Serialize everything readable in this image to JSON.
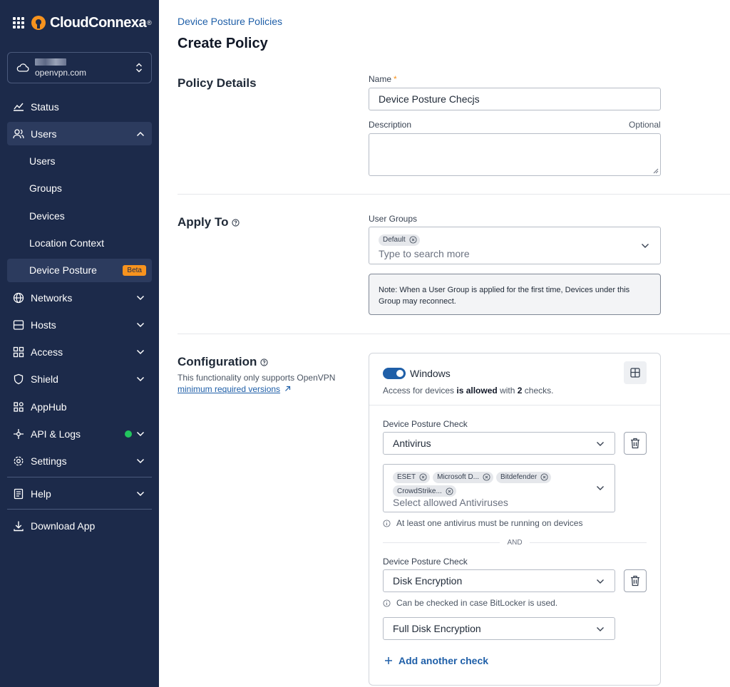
{
  "brand": {
    "name": "CloudConnexa",
    "reg": "®"
  },
  "org": {
    "domain": "openvpn.com"
  },
  "sidebar": {
    "items": [
      {
        "label": "Status"
      },
      {
        "label": "Users"
      },
      {
        "label": "Users"
      },
      {
        "label": "Groups"
      },
      {
        "label": "Devices"
      },
      {
        "label": "Location Context"
      },
      {
        "label": "Device Posture",
        "badge": "Beta"
      },
      {
        "label": "Networks"
      },
      {
        "label": "Hosts"
      },
      {
        "label": "Access"
      },
      {
        "label": "Shield"
      },
      {
        "label": "AppHub"
      },
      {
        "label": "API & Logs"
      },
      {
        "label": "Settings"
      },
      {
        "label": "Help"
      },
      {
        "label": "Download App"
      }
    ]
  },
  "header": {
    "breadcrumb": "Device Posture Policies",
    "title": "Create Policy"
  },
  "policy_details": {
    "title": "Policy Details",
    "name_label": "Name",
    "name_required": "*",
    "name_value": "Device Posture Checjs",
    "description_label": "Description",
    "description_optional": "Optional",
    "description_value": ""
  },
  "apply_to": {
    "title": "Apply To",
    "user_groups_label": "User Groups",
    "chips": [
      "Default"
    ],
    "search_placeholder": "Type to search more",
    "note": "Note: When a User Group is applied for the first time, Devices under this Group may reconnect."
  },
  "configuration": {
    "title": "Configuration",
    "subtitle": "This functionality only supports OpenVPN",
    "link": "minimum required versions",
    "os_name": "Windows",
    "access_pre": "Access for devices ",
    "access_bold": "is allowed",
    "access_mid": " with ",
    "access_count": "2",
    "access_post": " checks.",
    "check1": {
      "label": "Device Posture Check",
      "value": "Antivirus",
      "chips": [
        "ESET",
        "Microsoft D...",
        "Bitdefender",
        "CrowdStrike..."
      ],
      "placeholder": "Select allowed Antiviruses",
      "info": "At least one antivirus must be running on devices"
    },
    "and_label": "AND",
    "check2": {
      "label": "Device Posture Check",
      "value": "Disk Encryption",
      "info": "Can be checked in case BitLocker is used.",
      "sub_value": "Full Disk Encryption"
    },
    "add_check": "Add another check"
  },
  "colors": {
    "sidebar_bg": "#1c2a4a",
    "accent": "#1f5fa8",
    "brand_orange": "#f7931e",
    "status_green": "#22c55e"
  }
}
